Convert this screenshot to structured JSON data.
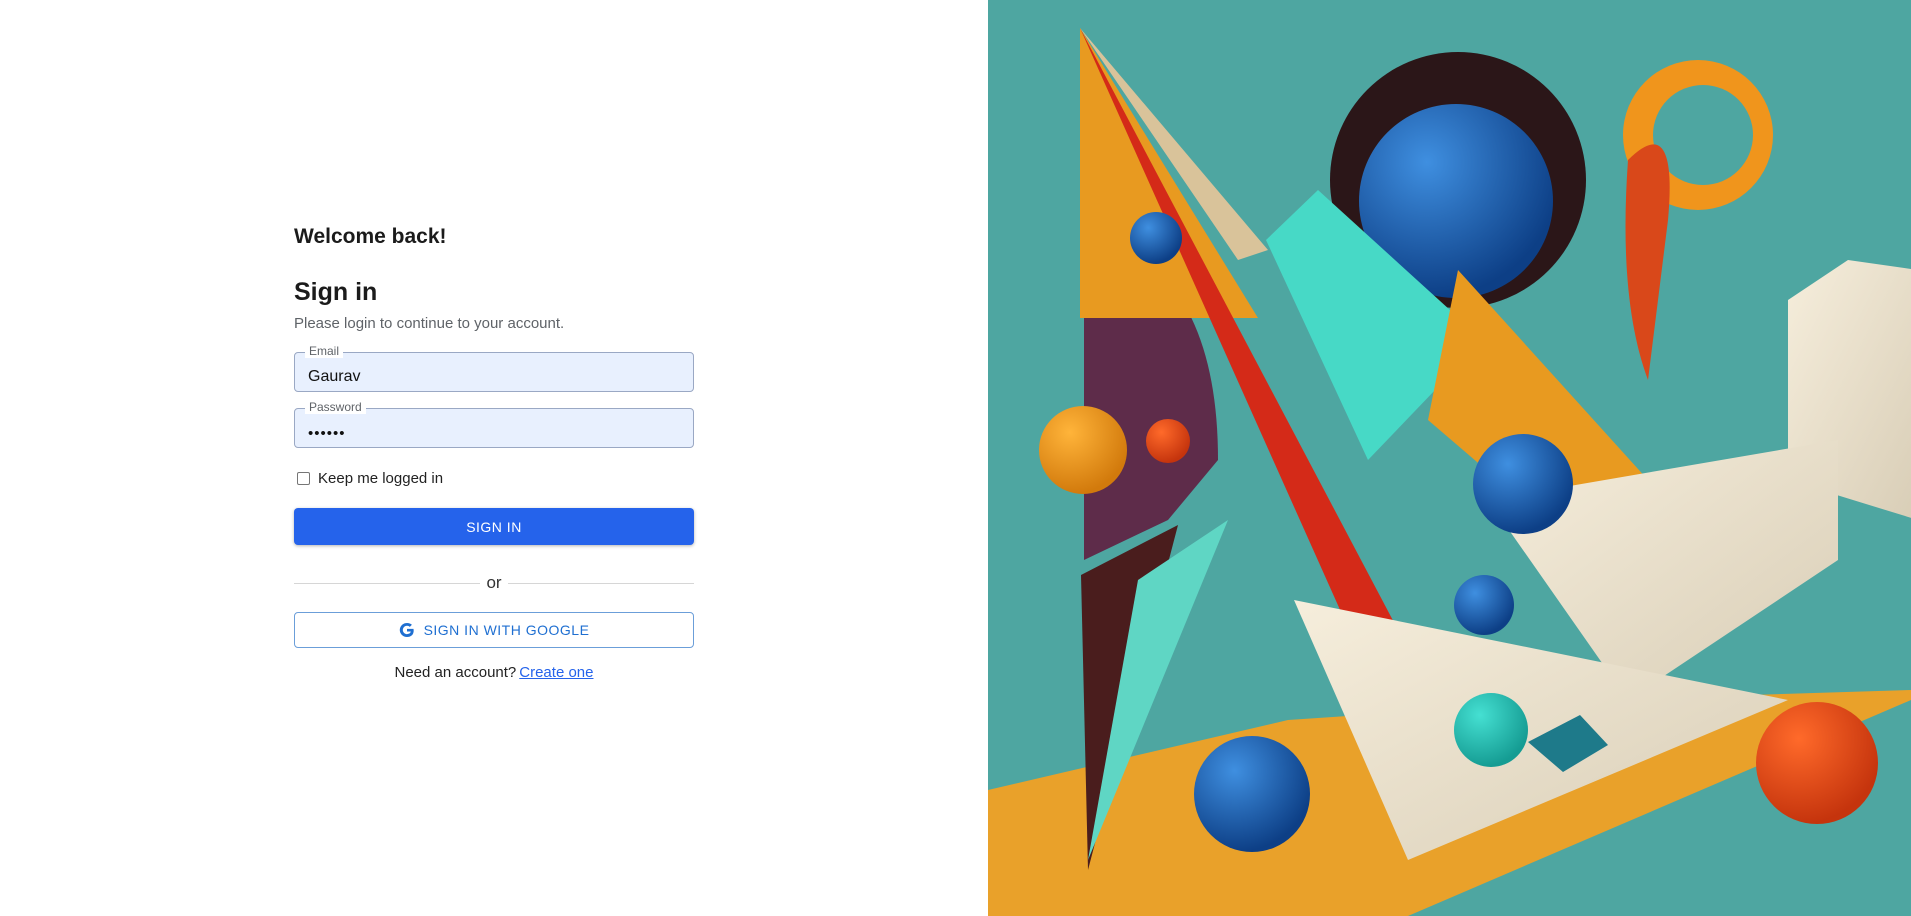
{
  "form": {
    "welcome": "Welcome back!",
    "title": "Sign in",
    "subtitle": "Please login to continue to your account.",
    "email": {
      "label": "Email",
      "value": "Gaurav"
    },
    "password": {
      "label": "Password",
      "value": "••••••"
    },
    "remember_label": "Keep me logged in",
    "remember_checked": false,
    "signin_label": "SIGN IN",
    "divider_text": "or",
    "google_label": "SIGN IN WITH GOOGLE",
    "footer_text": "Need an account?",
    "footer_link": "Create one"
  },
  "colors": {
    "primary": "#2563eb",
    "input_bg": "#e8f0fe",
    "art_bg": "#4ea6a1"
  },
  "icons": {
    "google": "google-g-icon"
  }
}
